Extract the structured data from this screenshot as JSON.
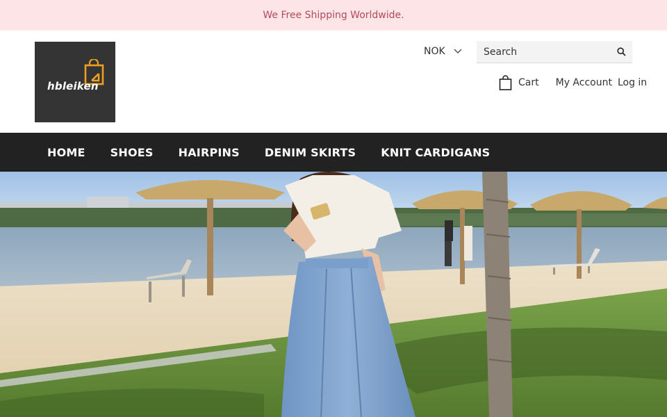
{
  "announcement": {
    "text": "We Free Shipping Worldwide."
  },
  "logo": {
    "text": "hbleiken"
  },
  "header": {
    "currency": "NOK",
    "search_placeholder": "Search",
    "cart_label": "Cart",
    "my_account_label": "My Account",
    "login_label": "Log in"
  },
  "nav": {
    "items": [
      {
        "label": "HOME"
      },
      {
        "label": "SHOES"
      },
      {
        "label": "HAIRPINS"
      },
      {
        "label": "DENIM SKIRTS"
      },
      {
        "label": "KNIT CARDIGANS"
      }
    ]
  },
  "icons": {
    "currency_dropdown": "chevron-down-icon",
    "search": "search-icon",
    "cart": "shopping-bag-icon",
    "logo_mark": "shopping-bag-arrow-icon"
  },
  "colors": {
    "announcement_bg": "#fde4e6",
    "announcement_text": "#b24a5c",
    "nav_bg": "#222222",
    "logo_bg": "#343434",
    "logo_accent": "#f0a020"
  }
}
